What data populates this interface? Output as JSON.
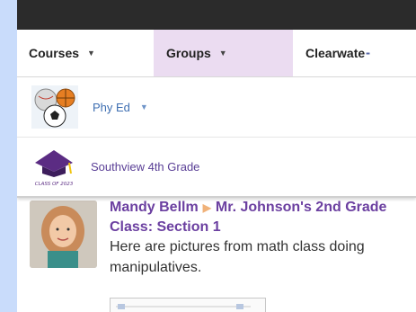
{
  "nav": {
    "courses": "Courses",
    "groups": "Groups",
    "clearwater": "Clearwate",
    "clearwater_overflow": "▪▪"
  },
  "dropdown": {
    "items": [
      {
        "label": "Phy Ed",
        "icon": "sports-balls-icon"
      },
      {
        "label": "Southview 4th Grade",
        "icon": "class-of-2023-logo"
      }
    ],
    "logo_text": "CLASS OF 2023"
  },
  "post": {
    "author": "Mandy Bellm",
    "target": "Mr. Johnson's 2nd Grade Class: Section 1",
    "body": "Here are pictures from math class doing manipulatives."
  },
  "colors": {
    "accent_purple": "#6b3fa0",
    "link_blue": "#3f6fb2",
    "groups_highlight": "#ebdcf1",
    "topbar": "#2b2b2b",
    "page_background": "#c9dcfb"
  }
}
